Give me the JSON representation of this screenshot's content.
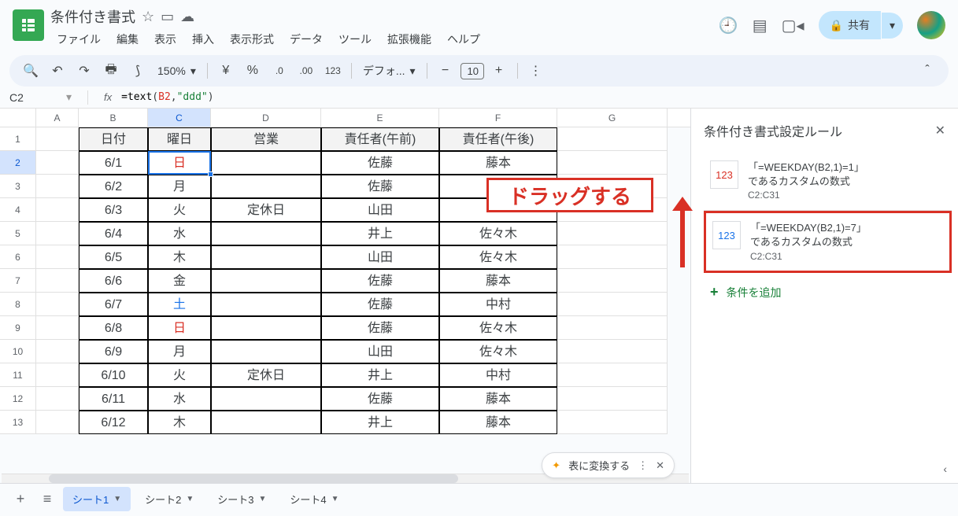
{
  "doc": {
    "title": "条件付き書式"
  },
  "menu": [
    {
      "l": "ファイル"
    },
    {
      "l": "編集"
    },
    {
      "l": "表示"
    },
    {
      "l": "挿入"
    },
    {
      "l": "表示形式"
    },
    {
      "l": "データ"
    },
    {
      "l": "ツール"
    },
    {
      "l": "拡張機能"
    },
    {
      "l": "ヘルプ"
    }
  ],
  "share": {
    "label": "共有"
  },
  "toolbar": {
    "zoom": "150%",
    "font": "デフォ...",
    "fontsize": "10",
    "currency": "¥",
    "percent": "%",
    "dec_dec": ".0",
    "dec_inc": ".00",
    "num": "123"
  },
  "formula": {
    "cell": "C2",
    "fn": "=text",
    "open": "(",
    "arg1": "B2",
    "sep": ",",
    "arg2": "\"ddd\"",
    "close": ")"
  },
  "columns": [
    "A",
    "B",
    "C",
    "D",
    "E",
    "F",
    "G"
  ],
  "table": {
    "header": {
      "B": "日付",
      "C": "曜日",
      "D": "営業",
      "E": "責任者(午前)",
      "F": "責任者(午後)"
    },
    "rows": [
      {
        "r": 2,
        "B": "6/1",
        "C": "日",
        "Ccls": "sun",
        "D": "",
        "E": "佐藤",
        "F": "藤本"
      },
      {
        "r": 3,
        "B": "6/2",
        "C": "月",
        "Ccls": "",
        "D": "",
        "E": "佐藤",
        "F": ""
      },
      {
        "r": 4,
        "B": "6/3",
        "C": "火",
        "Ccls": "",
        "D": "定休日",
        "E": "山田",
        "F": ""
      },
      {
        "r": 5,
        "B": "6/4",
        "C": "水",
        "Ccls": "",
        "D": "",
        "E": "井上",
        "F": "佐々木"
      },
      {
        "r": 6,
        "B": "6/5",
        "C": "木",
        "Ccls": "",
        "D": "",
        "E": "山田",
        "F": "佐々木"
      },
      {
        "r": 7,
        "B": "6/6",
        "C": "金",
        "Ccls": "",
        "D": "",
        "E": "佐藤",
        "F": "藤本"
      },
      {
        "r": 8,
        "B": "6/7",
        "C": "土",
        "Ccls": "sat",
        "D": "",
        "E": "佐藤",
        "F": "中村"
      },
      {
        "r": 9,
        "B": "6/8",
        "C": "日",
        "Ccls": "sun",
        "D": "",
        "E": "佐藤",
        "F": "佐々木"
      },
      {
        "r": 10,
        "B": "6/9",
        "C": "月",
        "Ccls": "",
        "D": "",
        "E": "山田",
        "F": "佐々木"
      },
      {
        "r": 11,
        "B": "6/10",
        "C": "火",
        "Ccls": "",
        "D": "定休日",
        "E": "井上",
        "F": "中村"
      },
      {
        "r": 12,
        "B": "6/11",
        "C": "水",
        "Ccls": "",
        "D": "",
        "E": "佐藤",
        "F": "藤本"
      },
      {
        "r": 13,
        "B": "6/12",
        "C": "木",
        "Ccls": "",
        "D": "",
        "E": "井上",
        "F": "藤本"
      }
    ]
  },
  "annotation": {
    "drag": "ドラッグする"
  },
  "convert": {
    "label": "表に変換する"
  },
  "sidebar": {
    "title": "条件付き書式設定ルール",
    "rules": [
      {
        "swatch": "123",
        "swatchCls": "red",
        "formula": "「=WEEKDAY(B2,1)=1」",
        "desc": "であるカスタムの数式",
        "range": "C2:C31"
      },
      {
        "swatch": "123",
        "swatchCls": "blue",
        "formula": "「=WEEKDAY(B2,1)=7」",
        "desc": "であるカスタムの数式",
        "range": "C2:C31"
      }
    ],
    "add": "条件を追加"
  },
  "tabs": [
    {
      "l": "シート1",
      "active": true
    },
    {
      "l": "シート2"
    },
    {
      "l": "シート3"
    },
    {
      "l": "シート4"
    }
  ]
}
